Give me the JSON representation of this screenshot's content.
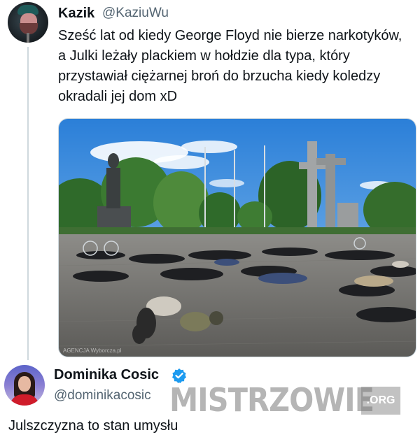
{
  "tweet1": {
    "name": "Kazik",
    "handle": "@KaziuWu",
    "text": "Sześć lat od kiedy George Floyd nie bierze narkotyków, a Julki leżały plackiem w hołdzie dla typa, który przystawiał ciężarnej broń do brzucha kiedy koledzy okradali jej dom xD",
    "photo_credit": "AGENCJA Wyborcza.pl"
  },
  "tweet2": {
    "name": "Dominika Cosic",
    "handle": "@dominikacosic",
    "text": "Julszczyzna to stan umysłu",
    "verified_icon": "verified-badge-icon",
    "verified_color": "#1d9bf0"
  },
  "watermark": {
    "main": "MISTRZOWIE",
    "tld": ".ORG"
  },
  "colors": {
    "text": "#0f1419",
    "secondary": "#536471",
    "thread_line": "#cfd9de"
  }
}
